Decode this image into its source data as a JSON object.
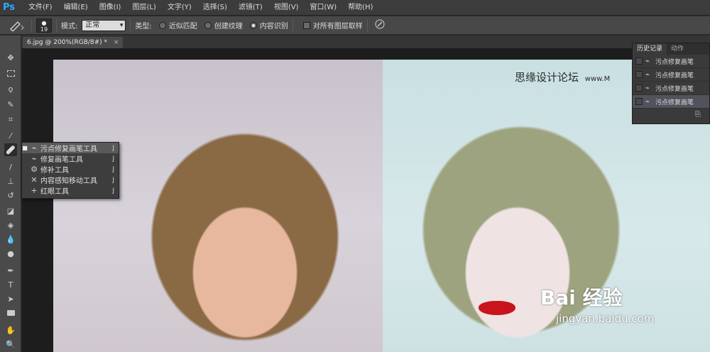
{
  "app": {
    "logo_text": "Ps"
  },
  "menu": [
    "文件(F)",
    "编辑(E)",
    "图像(I)",
    "图层(L)",
    "文字(Y)",
    "选择(S)",
    "滤镜(T)",
    "视图(V)",
    "窗口(W)",
    "帮助(H)"
  ],
  "options": {
    "brush_size": "19",
    "mode_label": "模式:",
    "mode_value": "正常",
    "type_label": "类型:",
    "radio_proximity": "近似匹配",
    "radio_texture": "创建纹理",
    "radio_content": "内容识别",
    "sample_all_label": "对所有图层取样",
    "selected_type": "内容识别"
  },
  "document": {
    "tab_title": "6.jpg @ 200%(RGB/8#) *",
    "close": "×"
  },
  "flyout": {
    "items": [
      {
        "label": "污点修复画笔工具",
        "key": "J",
        "icon": "spot-healing-brush-icon",
        "selected": true
      },
      {
        "label": "修复画笔工具",
        "key": "J",
        "icon": "healing-brush-icon",
        "selected": false
      },
      {
        "label": "修补工具",
        "key": "J",
        "icon": "patch-icon",
        "selected": false
      },
      {
        "label": "内容感知移动工具",
        "key": "J",
        "icon": "content-aware-move-icon",
        "selected": false
      },
      {
        "label": "红眼工具",
        "key": "J",
        "icon": "red-eye-icon",
        "selected": false
      }
    ]
  },
  "history": {
    "tab_history": "历史记录",
    "tab_actions": "动作",
    "rows": [
      {
        "label": "污点修复画笔"
      },
      {
        "label": "污点修复画笔"
      },
      {
        "label": "污点修复画笔"
      },
      {
        "label": "污点修复画笔"
      }
    ]
  },
  "watermarks": {
    "forum": "思缘设计论坛",
    "forum_url": "www.M",
    "baidu_logo": "Bai 经验",
    "baidu_url": "jingyan.baidu.com"
  }
}
